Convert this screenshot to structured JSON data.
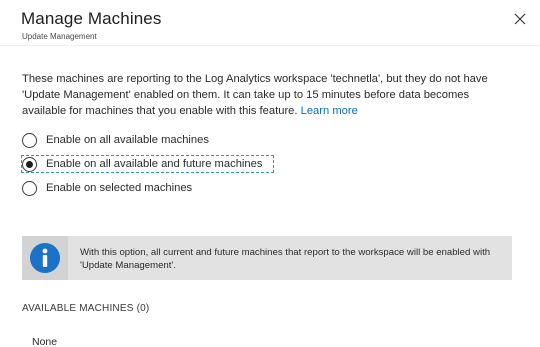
{
  "header": {
    "title": "Manage Machines",
    "subtitle": "Update Management",
    "close_icon": "close-icon"
  },
  "description": {
    "text": "These machines are reporting to the Log Analytics workspace 'technetla', but they do not have 'Update Management' enabled on them. It can take up to 15 minutes before data becomes available for machines that you enable with this feature. ",
    "link_text": "Learn more"
  },
  "options": {
    "selected_index": 1,
    "items": [
      {
        "label": "Enable on all available machines"
      },
      {
        "label": "Enable on all available and future machines"
      },
      {
        "label": "Enable on selected machines"
      }
    ]
  },
  "info_box": {
    "icon": "info-icon",
    "text": "With this option, all current and future machines that report to the workspace will be enabled with 'Update Management'."
  },
  "available_machines": {
    "heading": "AVAILABLE MACHINES (0)",
    "empty_text": "None"
  },
  "colors": {
    "link": "#0a6ebd",
    "info_icon": "#1a73c9",
    "focus_outline": "#2f8fd8"
  }
}
